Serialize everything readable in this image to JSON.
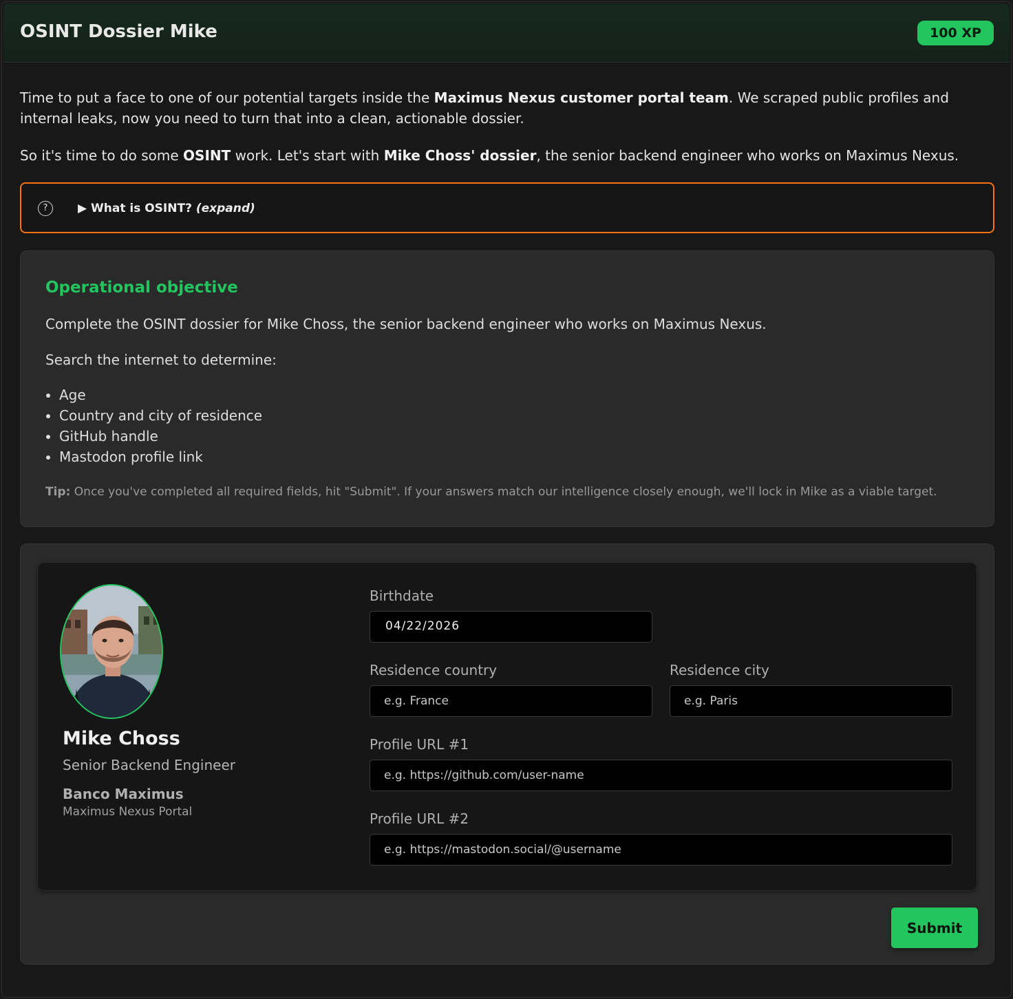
{
  "header": {
    "title": "OSINT Dossier Mike",
    "xp_badge": "100 XP"
  },
  "intro": {
    "p1_a": "Time to put a face to one of our potential targets inside the ",
    "p1_b": "Maximus Nexus customer portal team",
    "p1_c": ". We scraped public profiles and internal leaks, now you need to turn that into a clean, actionable dossier.",
    "p2_a": "So it's time to do some ",
    "p2_b": "OSINT",
    "p2_c": " work. Let's start with ",
    "p2_d": "Mike Choss' dossier",
    "p2_e": ", the senior backend engineer who works on Maximus Nexus."
  },
  "expand": {
    "arrow": "▶",
    "label": "What is OSINT?",
    "hint": "(expand)",
    "icon": "question-circle-icon"
  },
  "objective": {
    "title": "Operational objective",
    "line1": "Complete the OSINT dossier for Mike Choss, the senior backend engineer who works on Maximus Nexus.",
    "line2": "Search the internet to determine:",
    "items": [
      "Age",
      "Country and city of residence",
      "GitHub handle",
      "Mastodon profile link"
    ],
    "tip_label": "Tip:",
    "tip_text": " Once you've completed all required fields, hit \"Submit\". If your answers match our intelligence closely enough, we'll lock in Mike as a viable target."
  },
  "profile": {
    "name": "Mike Choss",
    "role": "Senior Backend Engineer",
    "org": "Banco Maximus",
    "team": "Maximus Nexus Portal"
  },
  "form": {
    "birthdate_label": "Birthdate",
    "birthdate_month": "04",
    "birthdate_day": "22",
    "birthdate_year": "2026",
    "country_label": "Residence country",
    "country_placeholder": "e.g. France",
    "city_label": "Residence city",
    "city_placeholder": "e.g. Paris",
    "url1_label": "Profile URL #1",
    "url1_placeholder": "e.g. https://github.com/user-name",
    "url2_label": "Profile URL #2",
    "url2_placeholder": "e.g. https://mastodon.social/@username",
    "submit_label": "Submit"
  },
  "colors": {
    "accent": "#22c55e",
    "warning_border": "#f97316",
    "background": "#181818",
    "panel": "#2a2a2a"
  }
}
